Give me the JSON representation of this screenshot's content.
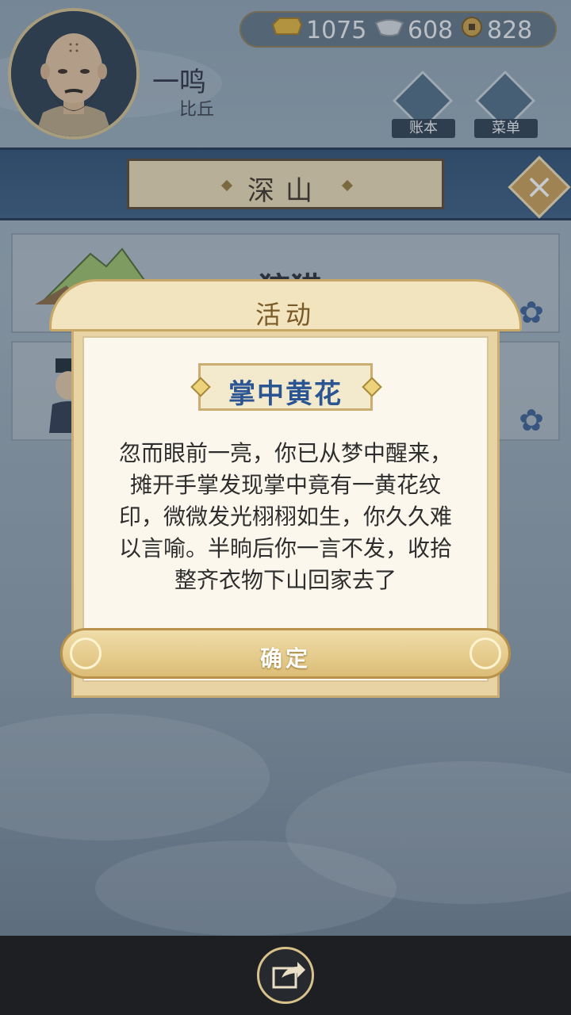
{
  "player": {
    "name": "一鸣",
    "title": "比丘"
  },
  "currency": {
    "gold": "1075",
    "silver": "608",
    "coins": "828"
  },
  "top_buttons": {
    "ledger_label": "账本",
    "menu_label": "菜单"
  },
  "scene": {
    "title": "深山",
    "card_title_partial": "狩猎"
  },
  "modal": {
    "header": "活动",
    "event_title": "掌中黄花",
    "body": "忽而眼前一亮，你已从梦中醒来，摊开手掌发现掌中竟有一黄花纹印，微微发光栩栩如生，你久久难以言喻。半晌后你一言不发，收拾整齐衣物下山回家去了",
    "confirm_label": "确定"
  },
  "icons": {
    "gold": "gold-ingot-icon",
    "silver": "silver-ingot-icon",
    "coins": "copper-coin-icon",
    "ledger": "ledger-icon",
    "menu": "menu-dots-icon",
    "close": "close-icon",
    "share": "share-icon"
  },
  "colors": {
    "accent_gold": "#c99e55",
    "title_blue": "#2a5592",
    "banner_blue": "#2f4f74"
  }
}
